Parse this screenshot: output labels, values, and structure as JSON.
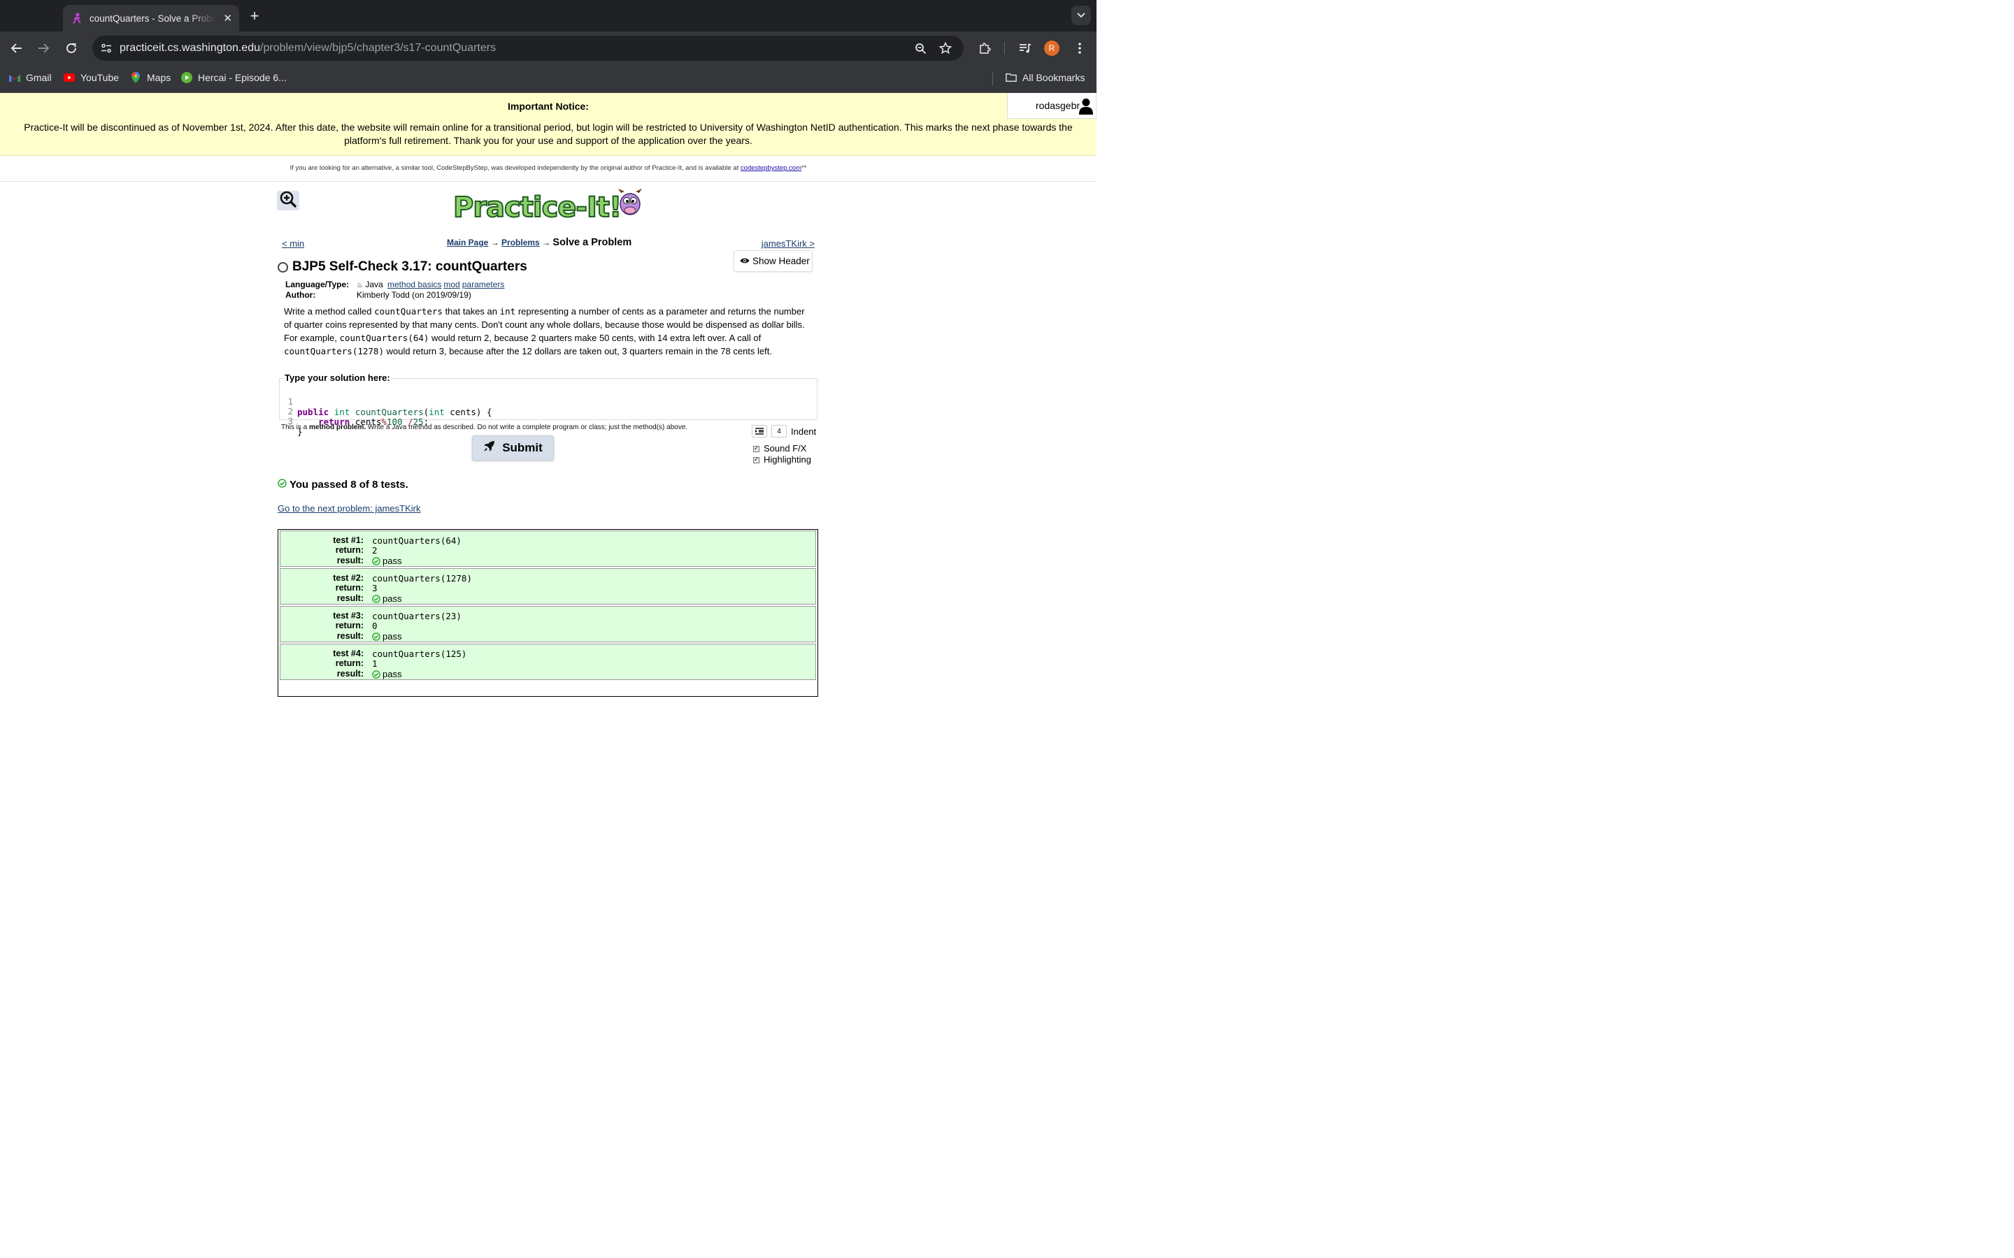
{
  "browser": {
    "tab_title": "countQuarters - Solve a Problem",
    "url_host": "practiceit.cs.washington.edu",
    "url_path": "/problem/view/bjp5/chapter3/s17-countQuarters",
    "profile_initial": "R",
    "bookmarks": [
      {
        "label": "Gmail",
        "icon": "gmail-icon"
      },
      {
        "label": "YouTube",
        "icon": "youtube-icon"
      },
      {
        "label": "Maps",
        "icon": "maps-icon"
      },
      {
        "label": "Hercai - Episode 6...",
        "icon": "play-icon"
      }
    ],
    "all_bookmarks": "All Bookmarks"
  },
  "notice": {
    "title": "Important Notice:",
    "text": "Practice-It will be discontinued as of November 1st, 2024. After this date, the website will remain online for a transitional period, but login will be restricted to University of Washington NetID authentication. This marks the next phase towards the platform's full retirement. Thank you for your use and support of the application over the years.",
    "username": "rodasgebr"
  },
  "alternative": {
    "text": "If you are looking for an alternative, a similar tool, CodeStepByStep, was developed independently by the original author of Practice-It, and is available at ",
    "link": "codestepbystep.com",
    "suffix": "**"
  },
  "nav": {
    "prev": "< min",
    "next": "jamesTKirk >",
    "main_page": "Main Page",
    "arrow": "→",
    "problems": "Problems",
    "current": "Solve a Problem",
    "show_header": "Show Header"
  },
  "problem": {
    "title": "BJP5 Self-Check 3.17: countQuarters",
    "language_label": "Language/Type:",
    "language": "Java",
    "tags": [
      "method basics",
      "mod",
      "parameters"
    ],
    "author_label": "Author:",
    "author": "Kimberly Todd (on 2019/09/19)",
    "desc": {
      "p1": "Write a method called ",
      "c1": "countQuarters",
      "p2": " that takes an ",
      "c2": "int",
      "p3": " representing a number of cents as a parameter and returns the number of quarter coins represented by that many cents. Don't count any whole dollars, because those would be dispensed as dollar bills. For example, ",
      "c3": "countQuarters(64)",
      "p4": " would return 2, because 2 quarters make 50 cents, with 14 extra left over. A call of ",
      "c4": "countQuarters(1278)",
      "p5": " would return 3, because after the 12 dollars are taken out, 3 quarters remain in the 78 cents left."
    }
  },
  "editor": {
    "label": "Type your solution here:",
    "lines": [
      "1",
      "2",
      "3"
    ],
    "code": {
      "l1_kw": "public",
      "l1_type": "int",
      "l1_name": "countQuarters",
      "l1_open": "(",
      "l1_ptype": "int",
      "l1_rest": " cents) {",
      "l2_indent": "    ",
      "l2_kw": "return",
      "l2_var": " cents",
      "l2_op1": "%",
      "l2_n1": "100",
      "l2_sp": " ",
      "l2_op2": "/",
      "l2_n2": "25",
      "l2_end": ";",
      "l3": "}"
    },
    "note_pre": "This is a ",
    "note_bold": "method problem.",
    "note_post": " Write a Java method as described. Do not write a complete program or class; just the method(s) above.",
    "indent_value": "4",
    "indent_label": "Indent",
    "submit": "Submit",
    "sound_fx": "Sound F/X",
    "highlighting": "Highlighting"
  },
  "results": {
    "summary": "You passed 8 of 8 tests.",
    "next_link": "Go to the next problem: jamesTKirk",
    "labels": {
      "return": "return:",
      "result": "result:"
    },
    "tests": [
      {
        "label": "test #1:",
        "call": "countQuarters(64)",
        "ret": "2",
        "result": "pass"
      },
      {
        "label": "test #2:",
        "call": "countQuarters(1278)",
        "ret": "3",
        "result": "pass"
      },
      {
        "label": "test #3:",
        "call": "countQuarters(23)",
        "ret": "0",
        "result": "pass"
      },
      {
        "label": "test #4:",
        "call": "countQuarters(125)",
        "ret": "1",
        "result": "pass"
      }
    ]
  },
  "colors": {
    "notice_bg": "#ffffcc",
    "pass_bg": "#ddffdd",
    "pass_icon": "#2fa52f",
    "link": "#1a3d6d"
  }
}
